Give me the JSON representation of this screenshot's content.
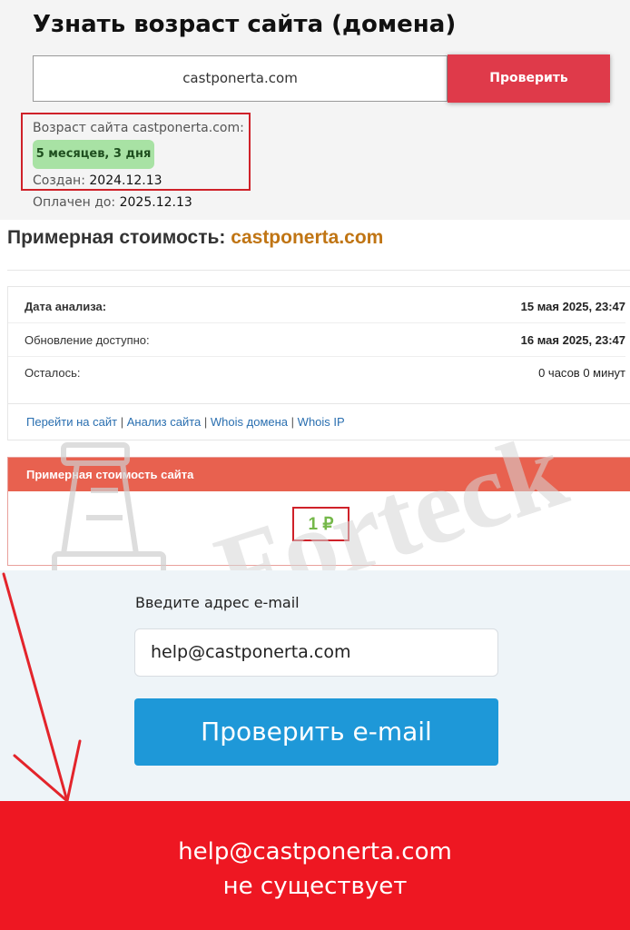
{
  "age_checker": {
    "title": "Узнать возраст сайта (домена)",
    "domain_value": "castponerta.com",
    "check_button": "Проверить",
    "age_label": "Возраст сайта castponerta.com:",
    "age_badge": "5 месяцев, 3 дня",
    "created_label": "Создан:",
    "created_value": "2024.12.13",
    "paid_label": "Оплачен до:",
    "paid_value": "2025.12.13"
  },
  "cost": {
    "title_prefix": "Примерная стоимость:",
    "title_domain": "castponerta.com",
    "rows": [
      {
        "label": "Дата анализа:",
        "value": "15 мая 2025, 23:47"
      },
      {
        "label": "Обновление доступно:",
        "value": "16 мая 2025, 23:47"
      },
      {
        "label": "Осталось:",
        "value": "0 часов 0 минут"
      }
    ],
    "links": [
      "Перейти на сайт",
      "Анализ сайта",
      "Whois домена",
      "Whois IP"
    ],
    "link_separator": "|",
    "price_header": "Примерная стоимость сайта",
    "price_value": "1 ₽"
  },
  "email_check": {
    "label": "Введите адрес e-mail",
    "input_value": "help@castponerta.com",
    "button": "Проверить e-mail"
  },
  "result": {
    "line1": "help@castponerta.com",
    "line2": "не существует"
  },
  "watermark": {
    "text": "Forteck"
  },
  "colors": {
    "check_button": "#df3a4a",
    "age_badge": "#a8e2a4",
    "highlight_border": "#cf2129",
    "cost_domain": "#c07514",
    "price_header": "#e8614f",
    "price_value": "#75b84a",
    "email_button": "#1e98d8",
    "result_banner": "#ee1722",
    "link": "#2a6fb0"
  },
  "icons": {
    "arrow": "red-arrow-annotation"
  }
}
